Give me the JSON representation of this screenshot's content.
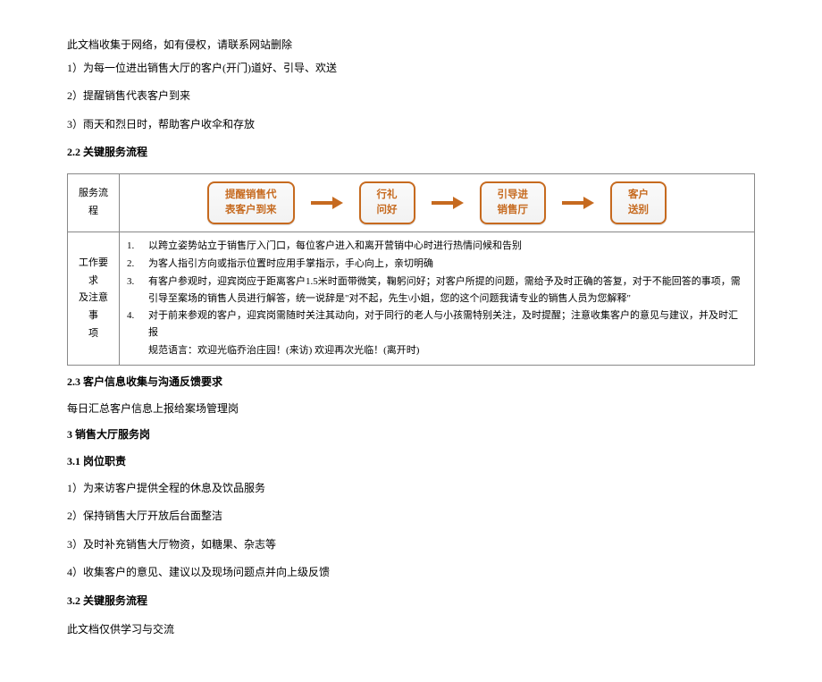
{
  "notice": "此文档收集于网络，如有侵权，请联系网站删除",
  "intro_items": [
    "1）为每一位进出销售大厅的客户(开门)道好、引导、欢送",
    "2）提醒销售代表客户到来",
    "3）雨天和烈日时，帮助客户收伞和存放"
  ],
  "heading_22": "2.2 关键服务流程",
  "table": {
    "row1_label": "服务流程",
    "flow": [
      "提醒销售代\n表客户到来",
      "行礼\n问好",
      "引导进\n销售厅",
      "客户\n送别"
    ],
    "row2_label": "工作要求\n及注意事\n项",
    "requirements": [
      {
        "n": "1.",
        "t": "以跨立姿势站立于销售厅入门口，每位客户进入和离开营销中心时进行热情问候和告别"
      },
      {
        "n": "2.",
        "t": "为客人指引方向或指示位置时应用手掌指示，手心向上，亲切明确"
      },
      {
        "n": "3.",
        "t": "有客户参观时，迎宾岗应于距离客户1.5米时面带微笑，鞠躬问好；对客户所提的问题，需给予及时正确的答复，对于不能回答的事项，需引导至案场的销售人员进行解答，统一说辞是\"对不起，先生\\小姐，您的这个问题我请专业的销售人员为您解释\""
      },
      {
        "n": "4.",
        "t": "对于前来参观的客户，迎宾岗需随时关注其动向，对于同行的老人与小孩需特别关注，及时提醒；注意收集客户的意见与建议，并及时汇报"
      },
      {
        "n": "",
        "t": "规范语言：欢迎光临乔治庄园！(来访) 欢迎再次光临！(离开时)"
      }
    ]
  },
  "heading_23": "2.3 客户信息收集与沟通反馈要求",
  "sub_23": "每日汇总客户信息上报给案场管理岗",
  "heading_3": "3 销售大厅服务岗",
  "heading_31": "3.1 岗位职责",
  "duties_31": [
    "1）为来访客户提供全程的休息及饮品服务",
    "2）保持销售大厅开放后台面整洁",
    "3）及时补充销售大厅物资，如糖果、杂志等",
    "4）收集客户的意见、建议以及现场问题点并向上级反馈"
  ],
  "heading_32": "3.2 关键服务流程",
  "footer": "此文档仅供学习与交流"
}
